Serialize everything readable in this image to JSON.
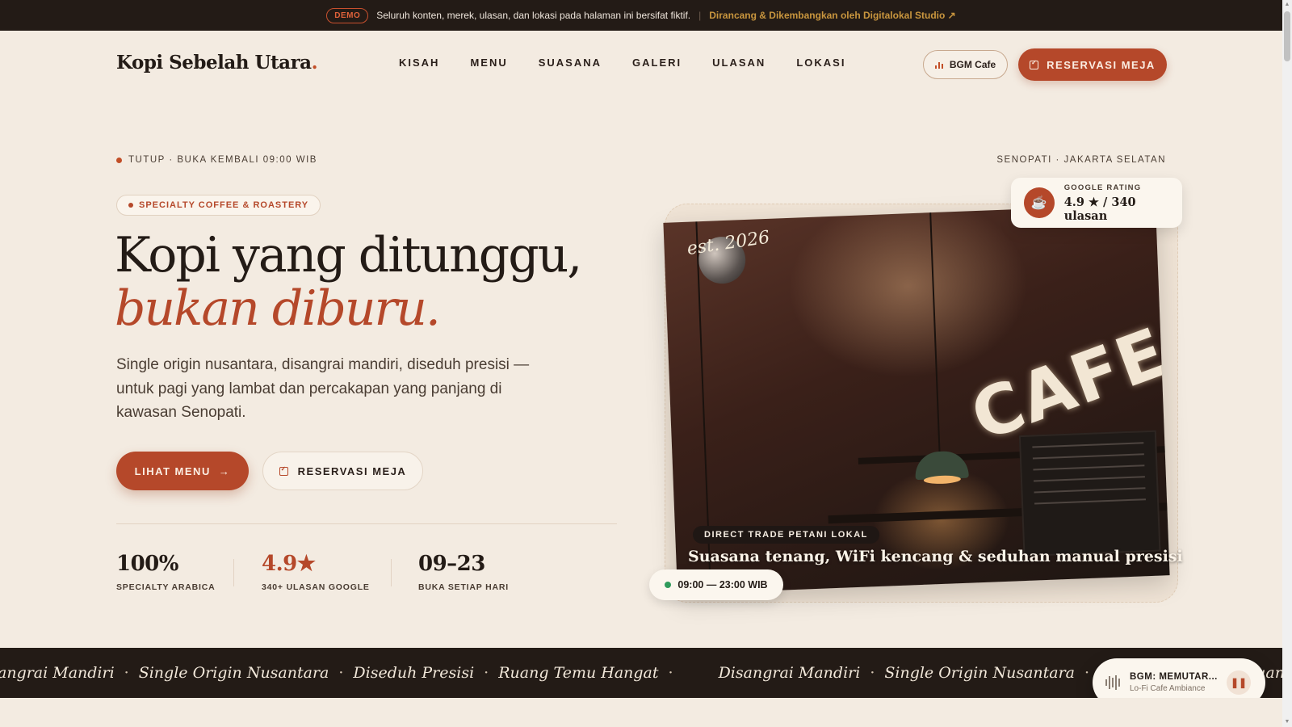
{
  "demo_bar": {
    "badge": "DEMO",
    "text": "Seluruh konten, merek, ulasan, dan lokasi pada halaman ini bersifat fiktif.",
    "separator": "|",
    "link": "Dirancang & Dikembangkan oleh Digitalokal Studio",
    "link_icon": "external-link-icon"
  },
  "header": {
    "logo": "Kopi Sebelah Utara",
    "logo_dot": ".",
    "nav": [
      "KISAH",
      "MENU",
      "SUASANA",
      "GALERI",
      "ULASAN",
      "LOKASI"
    ],
    "bgm_button": "BGM Cafe",
    "reserve_button": "RESERVASI MEJA"
  },
  "status": {
    "text": "TUTUP · BUKA KEMBALI 09:00 WIB",
    "location": "SENOPATI · JAKARTA SELATAN"
  },
  "hero": {
    "pill": "SPECIALTY COFFEE & ROASTERY",
    "title_line1": "Kopi yang ditunggu,",
    "title_line2": "bukan diburu.",
    "lead": "Single origin nusantara, disangrai mandiri, diseduh presisi — untuk pagi yang lambat dan percakapan yang panjang di kawasan Senopati.",
    "cta_menu": "LIHAT MENU",
    "cta_menu_arrow": "→",
    "cta_reserve": "RESERVASI MEJA",
    "stats": [
      {
        "value": "100%",
        "label": "SPECIALTY ARABICA"
      },
      {
        "value": "4.9★",
        "label": "340+ ULASAN GOOGLE"
      },
      {
        "value": "09–23",
        "label": "BUKA SETIAP HARI"
      }
    ]
  },
  "photo": {
    "est": "est. 2026",
    "sign": "CAFE",
    "tag": "DIRECT TRADE PETANI LOKAL",
    "caption": "Suasana tenang, WiFi kencang & seduhan manual presisi",
    "hours": "09:00 — 23:00 WIB"
  },
  "rating_card": {
    "label": "GOOGLE RATING",
    "value": "4.9 ★ / 340 ulasan",
    "icon": "coffee-cup-icon"
  },
  "marquee": {
    "items": [
      "angrai Mandiri",
      "Single Origin Nusantara",
      "Diseduh Presisi",
      "Ruang Temu Hangat",
      "Disangrai Mandiri",
      "Single Origin Nusantara",
      "Diseduh Presisi",
      "Ruang Temu Hangat"
    ],
    "separator": "·"
  },
  "player": {
    "title": "BGM: MEMUTAR...",
    "subtitle": "Lo-Fi Cafe Ambiance",
    "pause_icon": "pause-icon"
  },
  "colors": {
    "accent": "#b5482a",
    "dark": "#231b16",
    "background": "#f3ebe1",
    "open_indicator": "#2f9a5b"
  }
}
